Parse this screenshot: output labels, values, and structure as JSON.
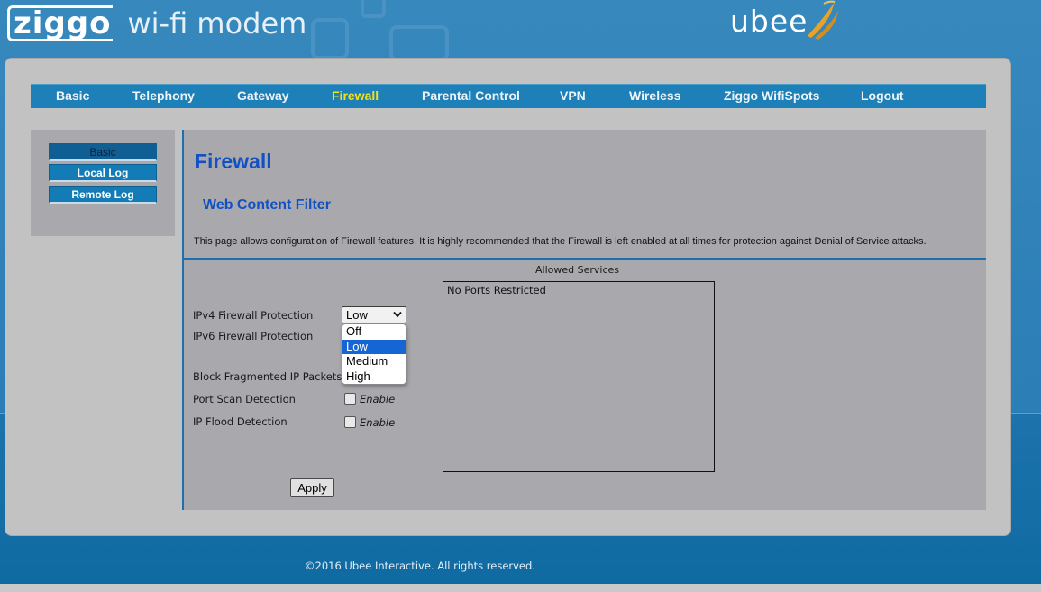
{
  "header": {
    "brand": "ziggo",
    "product": "wi-fi modem",
    "vendor": "ubee"
  },
  "nav": {
    "items": [
      "Basic",
      "Telephony",
      "Gateway",
      "Firewall",
      "Parental Control",
      "VPN",
      "Wireless",
      "Ziggo WifiSpots",
      "Logout"
    ],
    "active": "Firewall"
  },
  "sidebar": {
    "items": [
      "Basic",
      "Local Log",
      "Remote Log"
    ],
    "active": "Basic"
  },
  "content": {
    "title": "Firewall",
    "subtitle": "Web Content Filter",
    "description": "This page allows configuration of Firewall features. It is highly recommended that the Firewall is left enabled at all times for protection against Denial of Service attacks.",
    "fields": {
      "ipv4_label": "IPv4 Firewall Protection",
      "ipv6_label": "IPv6 Firewall Protection",
      "fragmented_label": "Block Fragmented IP Packets",
      "portscan_label": "Port Scan Detection",
      "flood_label": "IP Flood Detection"
    },
    "ipv4_select": {
      "value": "Low",
      "options": [
        "Off",
        "Low",
        "Medium",
        "High"
      ],
      "highlighted": "Low"
    },
    "checkbox_label": "Enable",
    "portscan_checked": false,
    "flood_checked": false,
    "allowed_services": {
      "title": "Allowed Services",
      "text": "No Ports Restricted"
    },
    "apply_label": "Apply"
  },
  "footer": {
    "copyright": "©2016 Ubee Interactive. All rights reserved."
  },
  "colors": {
    "nav_bg": "#1e80b9",
    "nav_active": "#f2e21e",
    "title_blue": "#1151c4",
    "panel_bg": "#a9a8ac",
    "select_highlight": "#1565d4"
  }
}
